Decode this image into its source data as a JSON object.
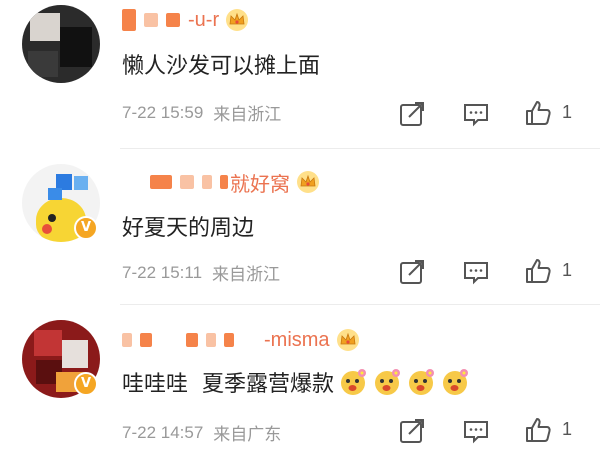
{
  "comments": [
    {
      "name_suffix": "-u-r",
      "text": "懒人沙发可以摊上面",
      "time": "7-22 15:59",
      "source": "来自浙江",
      "likes": "1",
      "verified": false
    },
    {
      "name_suffix": "就好窝",
      "text": "好夏天的周边",
      "time": "7-22 15:11",
      "source": "来自浙江",
      "likes": "1",
      "verified": true
    },
    {
      "name_suffix": "-misma",
      "text": "哇哇哇  夏季露营爆款",
      "time": "7-22 14:57",
      "source": "来自广东",
      "likes": "1",
      "verified": true
    }
  ],
  "colors": {
    "name": "#eb7350",
    "meta": "#999999",
    "badge": "#f5a623"
  },
  "icons": [
    "crown-icon",
    "share-icon",
    "comment-icon",
    "like-icon",
    "verified-badge-icon",
    "flower-face-emoji-icon"
  ]
}
